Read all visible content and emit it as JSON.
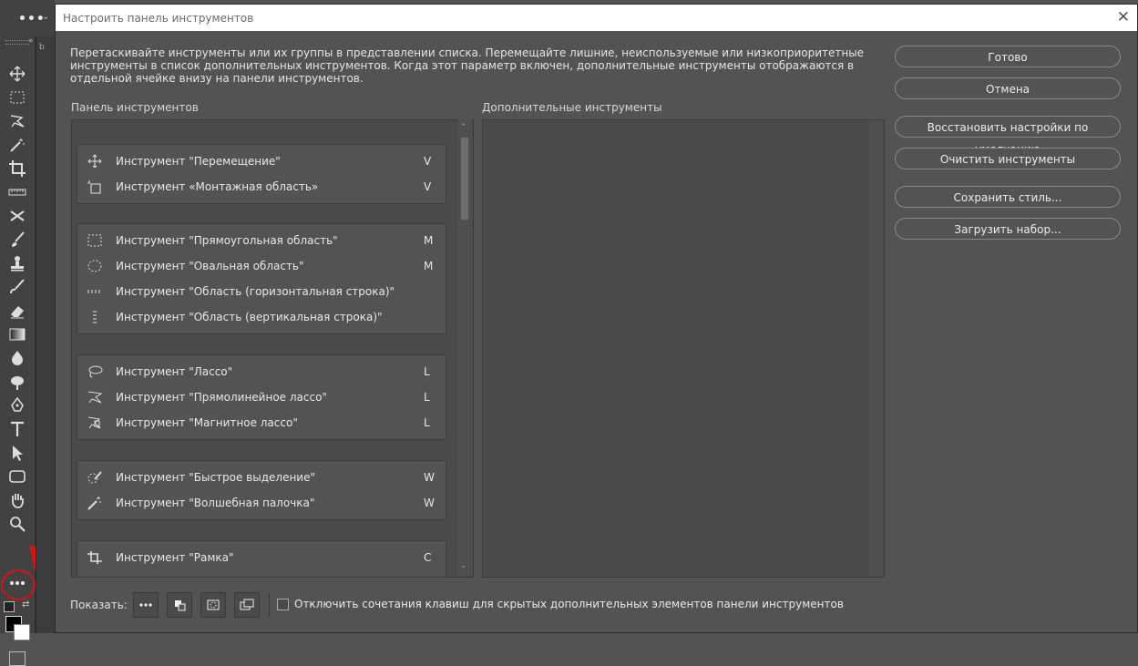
{
  "dialog": {
    "title": "Настроить панель инструментов",
    "description": "Перетаскивайте инструменты или их группы в представлении списка. Перемещайте лишние, неиспользуемые или низкоприоритетные инструменты в список дополнительных инструментов. Когда этот параметр включен, дополнительные инструменты отображаются в отдельной ячейке внизу на панели инструментов.",
    "toolbar_panel_label": "Панель инструментов",
    "extra_panel_label": "Дополнительные инструменты"
  },
  "groups": [
    {
      "items": [
        {
          "label": "Инструмент \"Перемещение\"",
          "key": "V",
          "icon": "move-icon"
        },
        {
          "label": "Инструмент «Монтажная область»",
          "key": "V",
          "icon": "artboard-icon"
        }
      ]
    },
    {
      "items": [
        {
          "label": "Инструмент \"Прямоугольная область\"",
          "key": "M",
          "icon": "rect-marquee-icon"
        },
        {
          "label": "Инструмент \"Овальная область\"",
          "key": "M",
          "icon": "ellipse-marquee-icon"
        },
        {
          "label": "Инструмент \"Область (горизонтальная строка)\"",
          "key": "",
          "icon": "single-row-marquee-icon"
        },
        {
          "label": "Инструмент \"Область (вертикальная строка)\"",
          "key": "",
          "icon": "single-column-marquee-icon"
        }
      ]
    },
    {
      "items": [
        {
          "label": "Инструмент \"Лассо\"",
          "key": "L",
          "icon": "lasso-icon"
        },
        {
          "label": "Инструмент \"Прямолинейное лассо\"",
          "key": "L",
          "icon": "polygonal-lasso-icon"
        },
        {
          "label": "Инструмент \"Магнитное лассо\"",
          "key": "L",
          "icon": "magnetic-lasso-icon"
        }
      ]
    },
    {
      "items": [
        {
          "label": "Инструмент \"Быстрое выделение\"",
          "key": "W",
          "icon": "quick-selection-icon"
        },
        {
          "label": "Инструмент \"Волшебная палочка\"",
          "key": "W",
          "icon": "magic-wand-icon"
        }
      ]
    },
    {
      "items": [
        {
          "label": "Инструмент \"Рамка\"",
          "key": "C",
          "icon": "crop-icon"
        }
      ]
    }
  ],
  "buttons": {
    "done": "Готово",
    "cancel": "Отмена",
    "restore_defaults": "Восстановить настройки по умолчанию",
    "clear_tools": "Очистить инструменты",
    "save_preset": "Сохранить стиль...",
    "load_preset": "Загрузить набор..."
  },
  "bottom": {
    "show_label": "Показать:",
    "checkbox_label": "Отключить сочетания клавиш для скрытых дополнительных элементов панели инструментов",
    "checkbox_checked": false
  },
  "topbar": {
    "more_label": "•••"
  },
  "colors": {
    "accent_red": "#d11616",
    "dialog_bg": "#535353",
    "panel_bg": "#4a4a4a"
  }
}
